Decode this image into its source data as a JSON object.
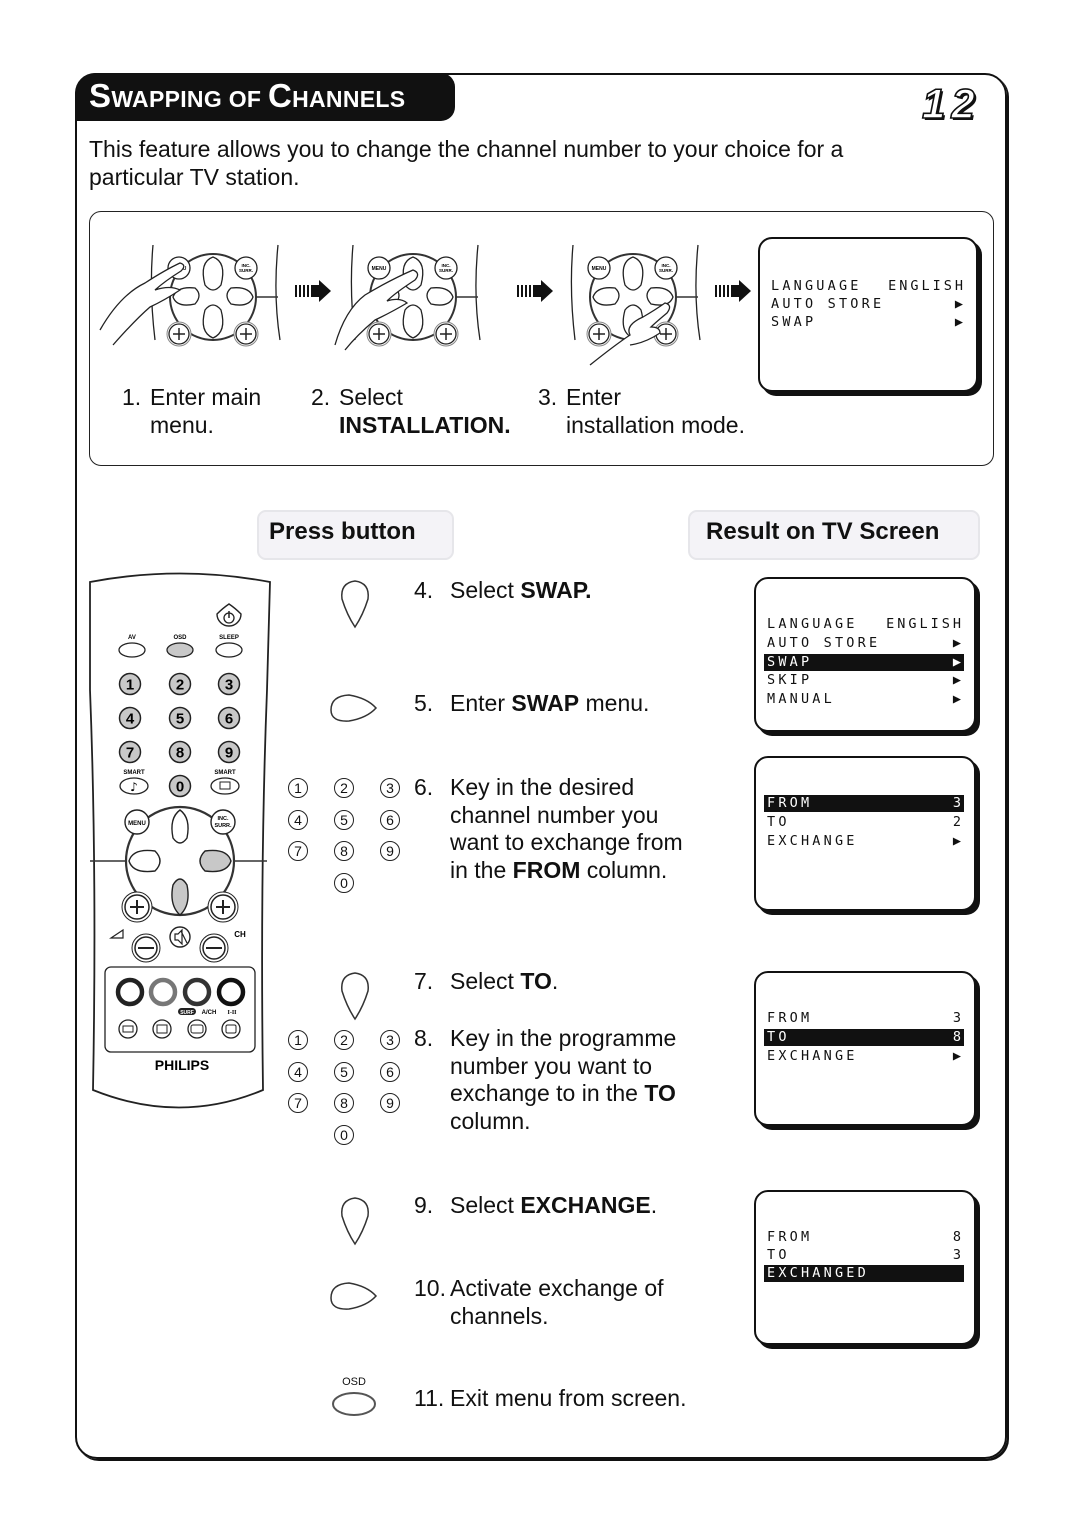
{
  "header": {
    "title_first": "S",
    "title_rest1": "WAPPING OF ",
    "title_second": "C",
    "title_rest2": "HANNELS",
    "page_number": "12"
  },
  "intro": {
    "line1": "This feature allows you to change the channel number to your choice for a",
    "line2": "particular TV station."
  },
  "top_steps": [
    {
      "num": "1.",
      "line1": "Enter main",
      "line2": "menu.",
      "line2_bold": false,
      "button_labels": {
        "menu": "MENU",
        "inc": "INC.",
        "surr": "SURR."
      }
    },
    {
      "num": "2.",
      "line1": "Select",
      "line2": "INSTALLATION.",
      "line2_bold": true
    },
    {
      "num": "3.",
      "line1": "Enter",
      "line2": "installation mode.",
      "line2_bold": false
    }
  ],
  "installation_screen": {
    "rows": [
      {
        "label": "LANGUAGE",
        "value": "ENGLISH",
        "highlighted": true
      },
      {
        "label": "AUTO STORE",
        "value": "▶",
        "highlighted": false
      },
      {
        "label": "SWAP",
        "value": "▶",
        "highlighted": false
      }
    ]
  },
  "columns": {
    "press_button": "Press button",
    "result": "Result on TV Screen"
  },
  "remote": {
    "labels": {
      "av": "AV",
      "osd": "OSD",
      "sleep": "SLEEP",
      "smart_left": "SMART",
      "smart_right": "SMART",
      "menu": "MENU",
      "inc": "INC.",
      "surr": "SURR.",
      "ch": "CH",
      "surf": "SURF",
      "ach": "A/CH",
      "dual": "I-II",
      "brand": "PHILIPS"
    },
    "digits": [
      "1",
      "2",
      "3",
      "4",
      "5",
      "6",
      "7",
      "8",
      "9",
      "0"
    ]
  },
  "steps": [
    {
      "num": "4.",
      "parts": [
        {
          "t": "Select "
        },
        {
          "t": "SWAP.",
          "b": true
        }
      ],
      "lines": []
    },
    {
      "num": "5.",
      "parts": [
        {
          "t": "Enter "
        },
        {
          "t": "SWAP",
          "b": true
        },
        {
          "t": " menu."
        }
      ],
      "lines": []
    },
    {
      "num": "6.",
      "first": "Key in the desired",
      "lines": [
        "channel number you",
        "want to exchange from"
      ],
      "last_pre": "in the ",
      "last_bold": "FROM",
      "last_post": " column."
    },
    {
      "num": "7.",
      "parts": [
        {
          "t": "Select "
        },
        {
          "t": "TO",
          "b": true
        },
        {
          "t": "."
        }
      ],
      "lines": []
    },
    {
      "num": "8.",
      "first": "Key in the programme",
      "lines": [
        "number you want to"
      ],
      "mid_pre": "exchange to in the ",
      "mid_bold": "TO",
      "last": "column."
    },
    {
      "num": "9.",
      "parts": [
        {
          "t": "Select "
        },
        {
          "t": "EXCHANGE",
          "b": true
        },
        {
          "t": "."
        }
      ],
      "lines": []
    },
    {
      "num": "10.",
      "first": "Activate exchange of",
      "lines": [
        "channels."
      ]
    },
    {
      "num": "11.",
      "first": "Exit menu from screen.",
      "lines": [],
      "button_label": "OSD"
    }
  ],
  "keypad_digits": [
    "1",
    "2",
    "3",
    "4",
    "5",
    "6",
    "7",
    "8",
    "9",
    "0"
  ],
  "screens": [
    {
      "rows": [
        {
          "label": "LANGUAGE",
          "value": "ENGLISH",
          "highlighted": false
        },
        {
          "label": "AUTO STORE",
          "value": "▶",
          "highlighted": false
        },
        {
          "label": "SWAP",
          "value": "▶",
          "highlighted": true
        },
        {
          "label": "SKIP",
          "value": "▶",
          "highlighted": false
        },
        {
          "label": "MANUAL",
          "value": "▶",
          "highlighted": false
        }
      ]
    },
    {
      "rows": [
        {
          "label": "FROM",
          "value": "3",
          "highlighted": true
        },
        {
          "label": "TO",
          "value": "2",
          "highlighted": false
        },
        {
          "label": "EXCHANGE",
          "value": "▶",
          "highlighted": false
        }
      ]
    },
    {
      "rows": [
        {
          "label": "FROM",
          "value": "3",
          "highlighted": false
        },
        {
          "label": "TO",
          "value": "8",
          "highlighted": true
        },
        {
          "label": "EXCHANGE",
          "value": "▶",
          "highlighted": false
        }
      ]
    },
    {
      "rows": [
        {
          "label": "FROM",
          "value": "8",
          "highlighted": false
        },
        {
          "label": "TO",
          "value": "3",
          "highlighted": false
        },
        {
          "label": "EXCHANGED",
          "value": "",
          "highlighted": true
        }
      ]
    }
  ],
  "colors": {
    "ink": "#111111",
    "highlighted_key": "#c8c8c8",
    "pill_bg": "#f4f3f7"
  }
}
